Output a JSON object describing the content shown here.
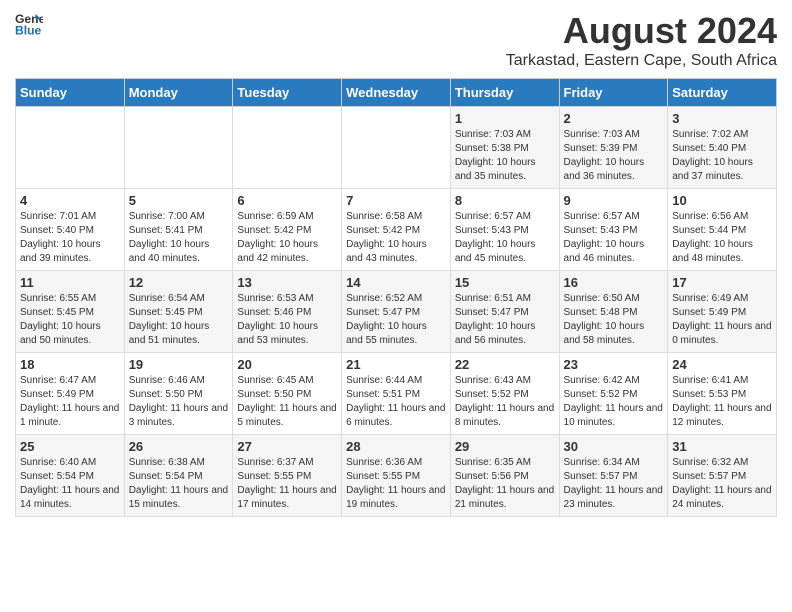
{
  "header": {
    "logo_general": "General",
    "logo_blue": "Blue",
    "title": "August 2024",
    "subtitle": "Tarkastad, Eastern Cape, South Africa"
  },
  "weekdays": [
    "Sunday",
    "Monday",
    "Tuesday",
    "Wednesday",
    "Thursday",
    "Friday",
    "Saturday"
  ],
  "weeks": [
    [
      {
        "day": "",
        "sunrise": "",
        "sunset": "",
        "daylight": ""
      },
      {
        "day": "",
        "sunrise": "",
        "sunset": "",
        "daylight": ""
      },
      {
        "day": "",
        "sunrise": "",
        "sunset": "",
        "daylight": ""
      },
      {
        "day": "",
        "sunrise": "",
        "sunset": "",
        "daylight": ""
      },
      {
        "day": "1",
        "sunrise": "Sunrise: 7:03 AM",
        "sunset": "Sunset: 5:38 PM",
        "daylight": "Daylight: 10 hours and 35 minutes."
      },
      {
        "day": "2",
        "sunrise": "Sunrise: 7:03 AM",
        "sunset": "Sunset: 5:39 PM",
        "daylight": "Daylight: 10 hours and 36 minutes."
      },
      {
        "day": "3",
        "sunrise": "Sunrise: 7:02 AM",
        "sunset": "Sunset: 5:40 PM",
        "daylight": "Daylight: 10 hours and 37 minutes."
      }
    ],
    [
      {
        "day": "4",
        "sunrise": "Sunrise: 7:01 AM",
        "sunset": "Sunset: 5:40 PM",
        "daylight": "Daylight: 10 hours and 39 minutes."
      },
      {
        "day": "5",
        "sunrise": "Sunrise: 7:00 AM",
        "sunset": "Sunset: 5:41 PM",
        "daylight": "Daylight: 10 hours and 40 minutes."
      },
      {
        "day": "6",
        "sunrise": "Sunrise: 6:59 AM",
        "sunset": "Sunset: 5:42 PM",
        "daylight": "Daylight: 10 hours and 42 minutes."
      },
      {
        "day": "7",
        "sunrise": "Sunrise: 6:58 AM",
        "sunset": "Sunset: 5:42 PM",
        "daylight": "Daylight: 10 hours and 43 minutes."
      },
      {
        "day": "8",
        "sunrise": "Sunrise: 6:57 AM",
        "sunset": "Sunset: 5:43 PM",
        "daylight": "Daylight: 10 hours and 45 minutes."
      },
      {
        "day": "9",
        "sunrise": "Sunrise: 6:57 AM",
        "sunset": "Sunset: 5:43 PM",
        "daylight": "Daylight: 10 hours and 46 minutes."
      },
      {
        "day": "10",
        "sunrise": "Sunrise: 6:56 AM",
        "sunset": "Sunset: 5:44 PM",
        "daylight": "Daylight: 10 hours and 48 minutes."
      }
    ],
    [
      {
        "day": "11",
        "sunrise": "Sunrise: 6:55 AM",
        "sunset": "Sunset: 5:45 PM",
        "daylight": "Daylight: 10 hours and 50 minutes."
      },
      {
        "day": "12",
        "sunrise": "Sunrise: 6:54 AM",
        "sunset": "Sunset: 5:45 PM",
        "daylight": "Daylight: 10 hours and 51 minutes."
      },
      {
        "day": "13",
        "sunrise": "Sunrise: 6:53 AM",
        "sunset": "Sunset: 5:46 PM",
        "daylight": "Daylight: 10 hours and 53 minutes."
      },
      {
        "day": "14",
        "sunrise": "Sunrise: 6:52 AM",
        "sunset": "Sunset: 5:47 PM",
        "daylight": "Daylight: 10 hours and 55 minutes."
      },
      {
        "day": "15",
        "sunrise": "Sunrise: 6:51 AM",
        "sunset": "Sunset: 5:47 PM",
        "daylight": "Daylight: 10 hours and 56 minutes."
      },
      {
        "day": "16",
        "sunrise": "Sunrise: 6:50 AM",
        "sunset": "Sunset: 5:48 PM",
        "daylight": "Daylight: 10 hours and 58 minutes."
      },
      {
        "day": "17",
        "sunrise": "Sunrise: 6:49 AM",
        "sunset": "Sunset: 5:49 PM",
        "daylight": "Daylight: 11 hours and 0 minutes."
      }
    ],
    [
      {
        "day": "18",
        "sunrise": "Sunrise: 6:47 AM",
        "sunset": "Sunset: 5:49 PM",
        "daylight": "Daylight: 11 hours and 1 minute."
      },
      {
        "day": "19",
        "sunrise": "Sunrise: 6:46 AM",
        "sunset": "Sunset: 5:50 PM",
        "daylight": "Daylight: 11 hours and 3 minutes."
      },
      {
        "day": "20",
        "sunrise": "Sunrise: 6:45 AM",
        "sunset": "Sunset: 5:50 PM",
        "daylight": "Daylight: 11 hours and 5 minutes."
      },
      {
        "day": "21",
        "sunrise": "Sunrise: 6:44 AM",
        "sunset": "Sunset: 5:51 PM",
        "daylight": "Daylight: 11 hours and 6 minutes."
      },
      {
        "day": "22",
        "sunrise": "Sunrise: 6:43 AM",
        "sunset": "Sunset: 5:52 PM",
        "daylight": "Daylight: 11 hours and 8 minutes."
      },
      {
        "day": "23",
        "sunrise": "Sunrise: 6:42 AM",
        "sunset": "Sunset: 5:52 PM",
        "daylight": "Daylight: 11 hours and 10 minutes."
      },
      {
        "day": "24",
        "sunrise": "Sunrise: 6:41 AM",
        "sunset": "Sunset: 5:53 PM",
        "daylight": "Daylight: 11 hours and 12 minutes."
      }
    ],
    [
      {
        "day": "25",
        "sunrise": "Sunrise: 6:40 AM",
        "sunset": "Sunset: 5:54 PM",
        "daylight": "Daylight: 11 hours and 14 minutes."
      },
      {
        "day": "26",
        "sunrise": "Sunrise: 6:38 AM",
        "sunset": "Sunset: 5:54 PM",
        "daylight": "Daylight: 11 hours and 15 minutes."
      },
      {
        "day": "27",
        "sunrise": "Sunrise: 6:37 AM",
        "sunset": "Sunset: 5:55 PM",
        "daylight": "Daylight: 11 hours and 17 minutes."
      },
      {
        "day": "28",
        "sunrise": "Sunrise: 6:36 AM",
        "sunset": "Sunset: 5:55 PM",
        "daylight": "Daylight: 11 hours and 19 minutes."
      },
      {
        "day": "29",
        "sunrise": "Sunrise: 6:35 AM",
        "sunset": "Sunset: 5:56 PM",
        "daylight": "Daylight: 11 hours and 21 minutes."
      },
      {
        "day": "30",
        "sunrise": "Sunrise: 6:34 AM",
        "sunset": "Sunset: 5:57 PM",
        "daylight": "Daylight: 11 hours and 23 minutes."
      },
      {
        "day": "31",
        "sunrise": "Sunrise: 6:32 AM",
        "sunset": "Sunset: 5:57 PM",
        "daylight": "Daylight: 11 hours and 24 minutes."
      }
    ]
  ]
}
